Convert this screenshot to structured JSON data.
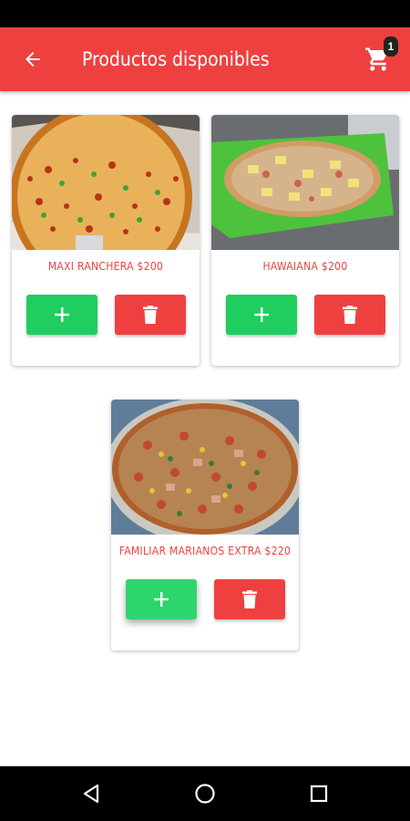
{
  "app": {
    "title": "Productos disponibles",
    "cart_count": "1",
    "accent_color": "#ef4040",
    "add_color": "#1fce5f"
  },
  "icons": {
    "back": "arrow-back-icon",
    "cart": "cart-icon",
    "add": "plus-icon",
    "delete": "trash-icon"
  },
  "products": [
    {
      "name": "MAXI RANCHERA $200"
    },
    {
      "name": "HAWAIANA $200"
    },
    {
      "name": "FAMILIAR MARIANOS EXTRA $220"
    }
  ],
  "system_nav": [
    "back-triangle-icon",
    "home-circle-icon",
    "recents-square-icon"
  ]
}
